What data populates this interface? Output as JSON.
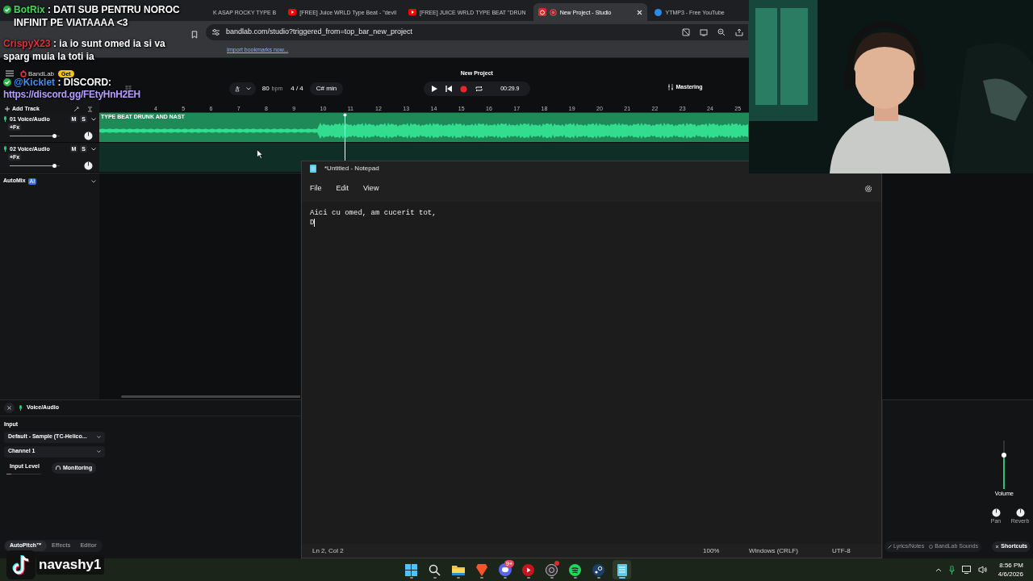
{
  "chat": {
    "messages": [
      {
        "user": "BotRix",
        "color": "#3ddc5a",
        "badge": true,
        "text": ": DATI SUB PENTRU NOROC INFINIT PE VIATAAAA <3"
      },
      {
        "user": "CrispyX23",
        "color": "#d8343c",
        "badge": false,
        "text": ": ia io sunt omed ia si va sparg muia la toti ia"
      },
      {
        "user": "@Kicklet",
        "color": "#3d8ff0",
        "badge": true,
        "text": ": DISCORD:",
        "link": "https://discord.gg/FEtyHnH2EH"
      }
    ]
  },
  "browser": {
    "tabs": [
      {
        "title": "K ASAP ROCKY TYPE B",
        "kind": "plain",
        "selected": false
      },
      {
        "title": "[FREE] Juice WRLD Type Beat - \"devil",
        "kind": "video",
        "selected": false
      },
      {
        "title": "[FREE] JUICE WRLD TYPE BEAT \"DRUN",
        "kind": "video",
        "selected": false
      },
      {
        "title": "New Project - Studio",
        "kind": "studio",
        "selected": true
      },
      {
        "title": "YTMP3 - Free YouTube",
        "kind": "site",
        "selected": false
      }
    ],
    "address": "bandlab.com/studio?triggered_from=top_bar_new_project",
    "bookmarks_link": "Import bookmarks now..."
  },
  "studio": {
    "logo": "BandLab",
    "get_badge": "Get",
    "title": "New Project",
    "bpm": "80",
    "bpm_unit": "bpm",
    "time_signature": "4 / 4",
    "key": "C# min",
    "time": "00:29.9",
    "mastering": "Mastering",
    "add_track": "Add Track",
    "ruler": [
      "4",
      "5",
      "6",
      "7",
      "8",
      "9",
      "10",
      "11",
      "12",
      "13",
      "14",
      "15",
      "16",
      "17",
      "18",
      "19",
      "20",
      "21",
      "22",
      "23",
      "24",
      "25"
    ],
    "tracks": [
      {
        "name": "01 Voice/Audio",
        "fx": "+Fx",
        "mute": "M",
        "solo": "S",
        "level": 0.9,
        "region": "TYPE BEAT DRUNK AND NAST"
      },
      {
        "name": "02 Voice/Audio",
        "fx": "+Fx",
        "mute": "M",
        "solo": "S",
        "level": 0.9
      }
    ],
    "automix": "AutoMix",
    "automix_badge": "AI"
  },
  "panel": {
    "track": "Voice/Audio",
    "input_label": "Input",
    "device": "Default - Sample (TC-Helico...",
    "channel": "Channel 1",
    "input_level_label": "Input Level",
    "input_level": {
      "level": 0.15
    },
    "monitoring": "Monitoring",
    "tabs": [
      {
        "label": "AutoPitch™",
        "selected": true
      },
      {
        "label": "Effects",
        "selected": false
      },
      {
        "label": "Editor",
        "selected": false
      }
    ],
    "volume": {
      "label": "Volume",
      "level": 0.7
    },
    "knobs": [
      "Pan",
      "Reverb"
    ],
    "footer": [
      "Lyrics/Notes",
      "BandLab Sounds"
    ],
    "shortcuts": "Shortcuts"
  },
  "notepad": {
    "title": "*Untitled - Notepad",
    "menu": [
      "File",
      "Edit",
      "View"
    ],
    "lines": [
      "Aici cu omed, am cucerit tot,",
      "D"
    ],
    "status": [
      "Ln 2, Col 2",
      "100%",
      "Windows (CRLF)",
      "UTF-8"
    ]
  },
  "taskbar": {
    "apps": [
      {
        "kind": "start",
        "active": false
      },
      {
        "kind": "search",
        "active": false
      },
      {
        "kind": "folder",
        "active": false
      },
      {
        "kind": "browser",
        "active": false
      },
      {
        "kind": "chat",
        "active": false,
        "badge": "9+"
      },
      {
        "kind": "player",
        "active": false
      },
      {
        "kind": "recorder",
        "active": false
      },
      {
        "kind": "music",
        "active": false
      },
      {
        "kind": "games",
        "active": false
      },
      {
        "kind": "notepad",
        "active": true
      }
    ],
    "time": "8:56 PM",
    "date": "4/6/2026"
  },
  "overlay": {
    "handle": "navashy1"
  }
}
